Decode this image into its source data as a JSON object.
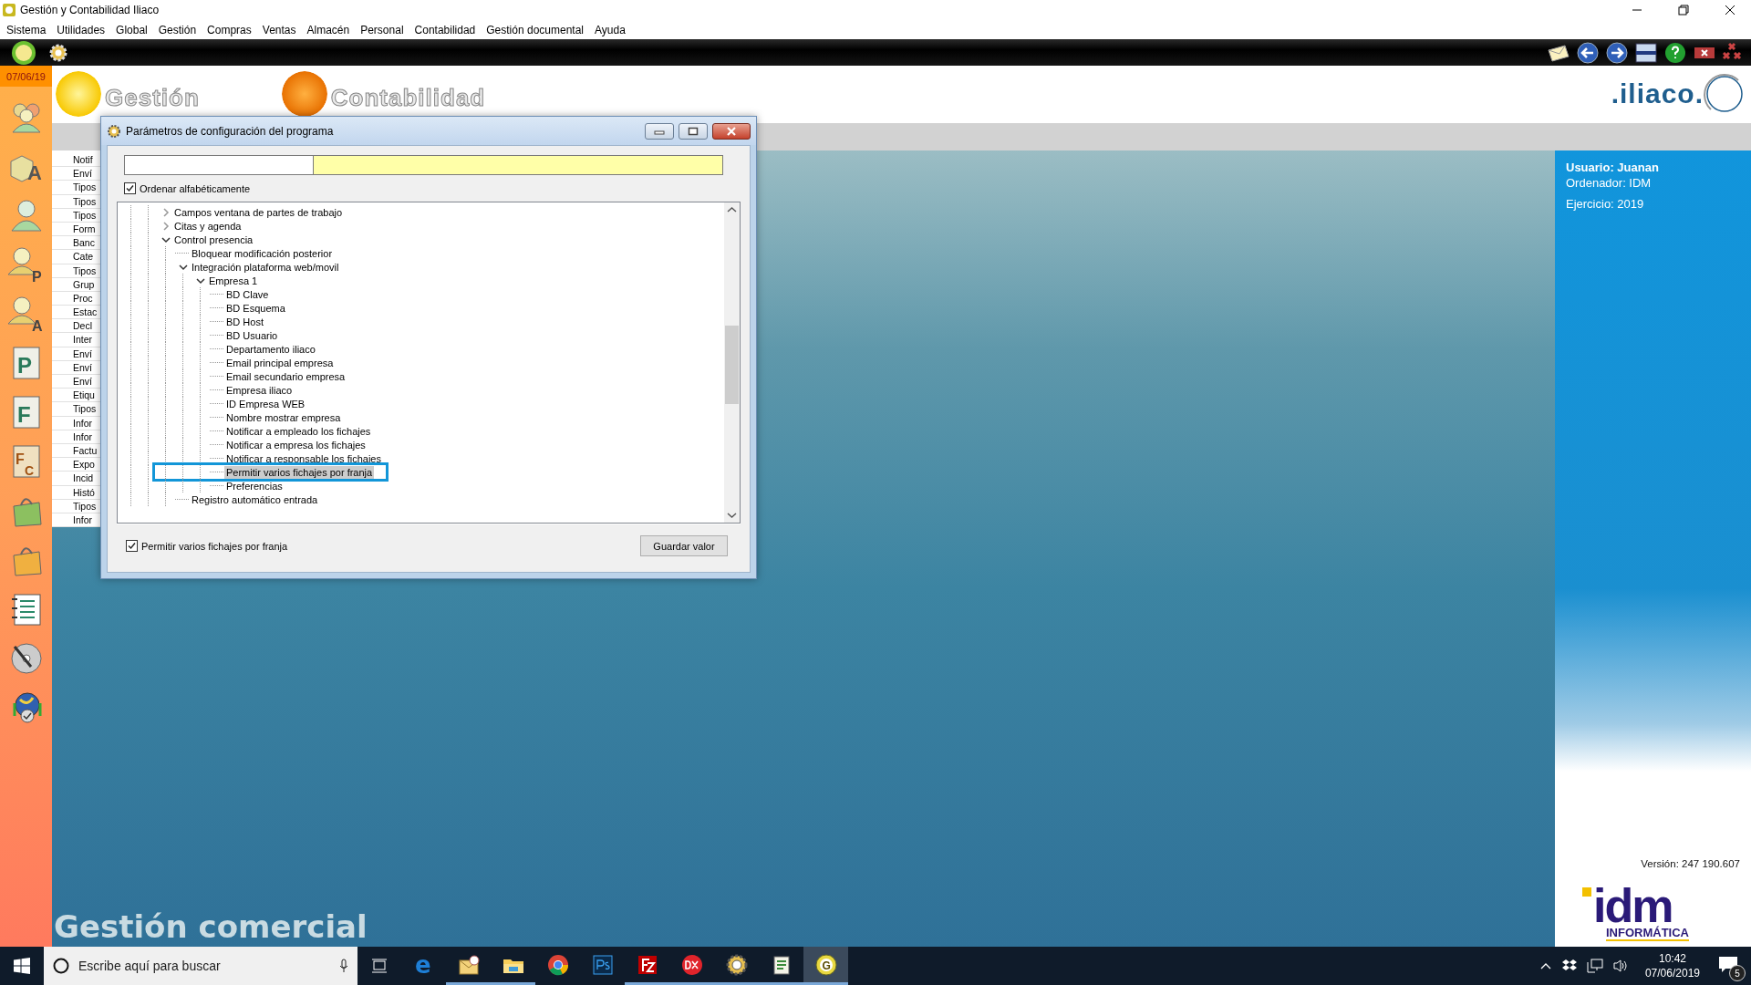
{
  "window": {
    "title": "Gestión y Contabilidad Iliaco"
  },
  "menu": [
    "Sistema",
    "Utilidades",
    "Global",
    "Gestión",
    "Compras",
    "Ventas",
    "Almacén",
    "Personal",
    "Contabilidad",
    "Gestión documental",
    "Ayuda"
  ],
  "date_badge": "07/06/19",
  "sidebar_icons": [
    {
      "kind": "people"
    },
    {
      "kind": "cube",
      "letter": "A"
    },
    {
      "kind": "person"
    },
    {
      "kind": "person_letter",
      "letter": "P"
    },
    {
      "kind": "person_letter",
      "letter": "A"
    },
    {
      "kind": "document",
      "letter": "P"
    },
    {
      "kind": "document",
      "letter": "F"
    },
    {
      "kind": "document_pair",
      "letter": "F",
      "letter_2": "C"
    },
    {
      "kind": "bag",
      "color": "#8cc060"
    },
    {
      "kind": "bag",
      "color": "#f0b040"
    },
    {
      "kind": "notebook"
    },
    {
      "kind": "disc"
    },
    {
      "kind": "globe"
    }
  ],
  "header": {
    "logo_1": "Gestión",
    "logo_2": "Contabilidad",
    "brand": ".iliaco."
  },
  "side_list": [
    "Notif",
    "Enví",
    "Tipos",
    "Tipos",
    "Tipos",
    "Form",
    "Banc",
    "Cate",
    "Tipos",
    "Grup",
    "Proc",
    "Estac",
    "Decl",
    "Inter",
    "Enví",
    "Enví",
    "Enví",
    "Etiqu",
    "Tipos",
    "Infor",
    "Infor",
    "Factu",
    "Expo",
    "Incid",
    "Histó",
    "Tipos",
    "Infor"
  ],
  "dialog": {
    "title": "Parámetros de configuración del programa",
    "sort_checkbox": {
      "label": "Ordenar alfabéticamente",
      "checked": true
    },
    "tree": [
      {
        "label": "Campos ventana de partes de trabajo",
        "expanded": false,
        "selected": false
      },
      {
        "label": "Citas y agenda",
        "expanded": false,
        "selected": false
      },
      {
        "label": "Control presencia",
        "expanded": true,
        "selected": false,
        "children": [
          {
            "label": "Bloquear modificación posterior",
            "selected": false
          },
          {
            "label": "Integración plataforma web/movil",
            "expanded": true,
            "selected": false,
            "children": [
              {
                "label": "Empresa 1",
                "expanded": true,
                "selected": false,
                "children": [
                  {
                    "label": "BD Clave",
                    "selected": false
                  },
                  {
                    "label": "BD Esquema",
                    "selected": false
                  },
                  {
                    "label": "BD Host",
                    "selected": false
                  },
                  {
                    "label": "BD Usuario",
                    "selected": false
                  },
                  {
                    "label": "Departamento iliaco",
                    "selected": false
                  },
                  {
                    "label": "Email principal empresa",
                    "selected": false
                  },
                  {
                    "label": "Email secundario empresa",
                    "selected": false
                  },
                  {
                    "label": "Empresa iliaco",
                    "selected": false
                  },
                  {
                    "label": "ID Empresa WEB",
                    "selected": false
                  },
                  {
                    "label": "Nombre mostrar empresa",
                    "selected": false
                  },
                  {
                    "label": "Notificar a empleado los fichajes",
                    "selected": false
                  },
                  {
                    "label": "Notificar a empresa los fichajes",
                    "selected": false
                  },
                  {
                    "label": "Notificar a responsable los fichajes",
                    "selected": false
                  },
                  {
                    "label": "Permitir varios fichajes por franja",
                    "selected": true
                  },
                  {
                    "label": "Preferencias",
                    "selected": false
                  }
                ]
              }
            ]
          },
          {
            "label": "Registro automático entrada",
            "selected": false
          }
        ]
      }
    ],
    "value_checkbox": {
      "label": "Permitir varios fichajes por franja",
      "checked": true
    },
    "save_button": "Guardar valor"
  },
  "user_panel": {
    "user": "Usuario: Juanan",
    "computer": "Ordenador: IDM",
    "year": "Ejercicio: 2019",
    "version": "Versión: 247 190.607",
    "company_logo": "idm",
    "company_sub": "INFORMÁTICA"
  },
  "module_title": "Gestión comercial",
  "taskbar": {
    "search_placeholder": "Escribe aquí para buscar",
    "apps": [
      {
        "kind": "edge",
        "letter": "e",
        "running": false,
        "selected": false
      },
      {
        "kind": "mail",
        "running": true,
        "selected": false
      },
      {
        "kind": "folder",
        "running": true,
        "selected": false
      },
      {
        "kind": "chrome",
        "running": false,
        "selected": false
      },
      {
        "kind": "photoshop",
        "running": false,
        "selected": false
      },
      {
        "kind": "filezilla",
        "running": true,
        "selected": false
      },
      {
        "kind": "dx",
        "running": true,
        "selected": false
      },
      {
        "kind": "gear",
        "running": true,
        "selected": false
      },
      {
        "kind": "notepad",
        "running": true,
        "selected": false
      },
      {
        "kind": "app",
        "letter": "G",
        "running": true,
        "selected": true
      }
    ],
    "time": "10:42",
    "date": "07/06/2019",
    "notifications": "5"
  }
}
